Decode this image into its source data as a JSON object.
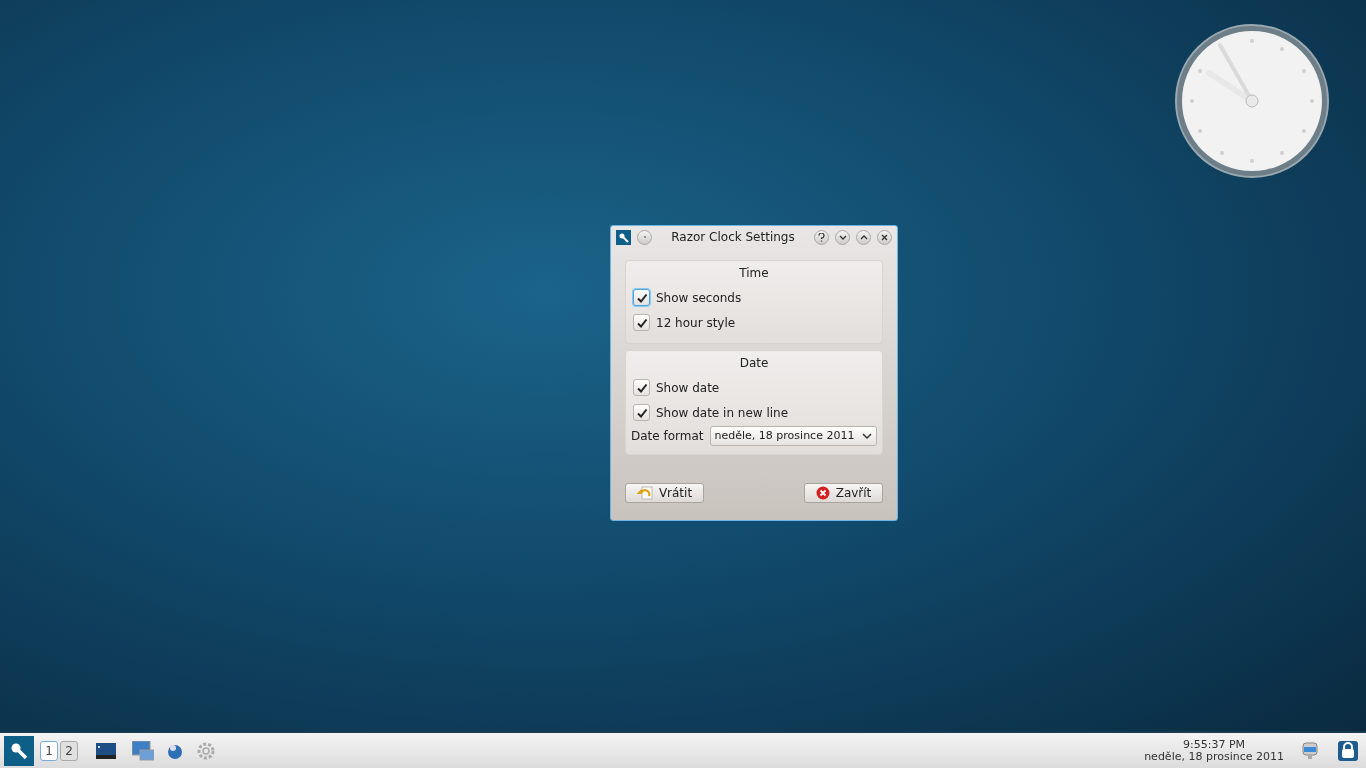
{
  "window": {
    "title": "Razor Clock Settings"
  },
  "groups": [
    {
      "title": "Time",
      "options": [
        {
          "label": "Show seconds",
          "checked": true,
          "focused": true
        },
        {
          "label": "12 hour style",
          "checked": true,
          "focused": false
        }
      ]
    },
    {
      "title": "Date",
      "options": [
        {
          "label": "Show date",
          "checked": true,
          "focused": false
        },
        {
          "label": "Show date in new line",
          "checked": true,
          "focused": false
        }
      ],
      "format": {
        "label": "Date format",
        "value": "neděle, 18 prosince 2011"
      }
    }
  ],
  "buttons": [
    {
      "label": "Vrátit",
      "kind": "reset"
    },
    {
      "label": "Zavřít",
      "kind": "close"
    }
  ],
  "taskbar": {
    "desktops": [
      {
        "label": "1",
        "selected": true
      },
      {
        "label": "2",
        "selected": false
      }
    ],
    "time": "9:55:37 PM",
    "date": "neděle, 18 prosince 2011"
  }
}
